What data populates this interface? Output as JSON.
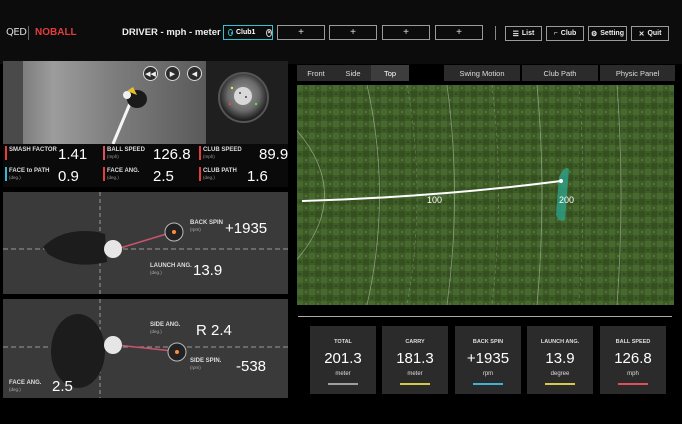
{
  "header": {
    "logo": "QED",
    "mode": "NOBALL",
    "club_title": "DRIVER - mph - meter",
    "active_tab": "Club1",
    "empty_tab": "+",
    "buttons": {
      "list": "List",
      "club": "Club",
      "setting": "Setting",
      "quit": "Quit"
    }
  },
  "shot_stats": {
    "smash_factor": {
      "label": "SMASH FACTOR",
      "value": "1.41"
    },
    "ball_speed": {
      "label": "BALL SPEED",
      "unit": "(mph)",
      "value": "126.8"
    },
    "club_speed": {
      "label": "CLUB SPEED",
      "unit": "(mph)",
      "value": "89.9"
    },
    "face_to_path": {
      "label": "FACE to PATH",
      "unit": "(deg.)",
      "value": "0.9"
    },
    "face_ang": {
      "label": "FACE ANG.",
      "unit": "(deg.)",
      "value": "2.5"
    },
    "club_path": {
      "label": "CLUB PATH",
      "unit": "(deg.)",
      "value": "1.6"
    }
  },
  "side_view": {
    "back_spin": {
      "label": "BACK SPIN",
      "unit": "(rpm)",
      "value": "+1935"
    },
    "launch_ang": {
      "label": "LAUNCH ANG.",
      "unit": "(deg.)",
      "value": "13.9"
    }
  },
  "top_view": {
    "side_ang": {
      "label": "SIDE ANG.",
      "unit": "(deg.)",
      "value": "R 2.4"
    },
    "side_spin": {
      "label": "SIDE SPIN.",
      "unit": "(rpm)",
      "value": "-538"
    },
    "face_ang": {
      "label": "FACE ANG.",
      "unit": "(deg.)",
      "value": "2.5"
    }
  },
  "view_tabs": [
    "Front",
    "Side",
    "Top"
  ],
  "selected_view": "Top",
  "panel_tabs": [
    "Swing Motion",
    "Club Path",
    "Physic Panel"
  ],
  "field_markers": [
    "100",
    "200"
  ],
  "summary": [
    {
      "title": "TOTAL",
      "value": "201.3",
      "unit": "meter",
      "color": "#9e9e9e"
    },
    {
      "title": "CARRY",
      "value": "181.3",
      "unit": "meter",
      "color": "#d6c94a"
    },
    {
      "title": "BACK SPIN",
      "value": "+1935",
      "unit": "rpm",
      "color": "#3fb3d6"
    },
    {
      "title": "LAUNCH ANG.",
      "value": "13.9",
      "unit": "degree",
      "color": "#d6c94a"
    },
    {
      "title": "BALL SPEED",
      "value": "126.8",
      "unit": "mph",
      "color": "#e04d5e"
    }
  ],
  "colors": {
    "accent": "#35c2cf",
    "noball": "#e33d3d"
  }
}
